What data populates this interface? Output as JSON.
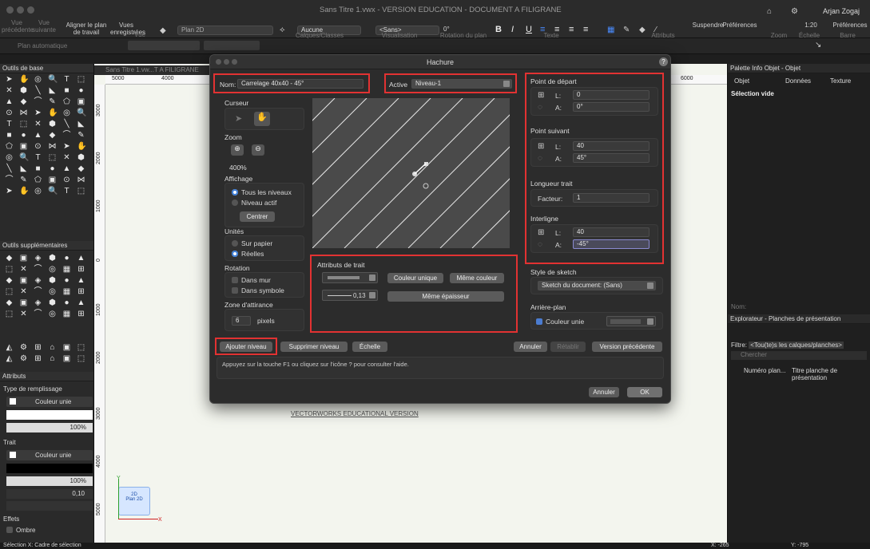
{
  "window": {
    "title": "Sans Titre 1.vwx - VERSION EDUCATION - DOCUMENT A FILIGRANE",
    "user": "Arjan Zogaj"
  },
  "toolbar": {
    "vue_precedente": "Vue précédente",
    "vue_suivante": "Vue suivante",
    "aligner": "Aligner le plan de travail",
    "vues_enregistrees": "Vues enregistrées",
    "vue_group": "Vue",
    "plan_2d": "Plan 2D",
    "calques_value": "Aucune",
    "calques_group": "Calques/Classes",
    "visu_group": "Visualisation",
    "sans_value": "<Sans>",
    "rotation_value": "0°",
    "rotation_group": "Rotation du plan",
    "texte_group": "Texte",
    "attributs_group": "Attributs",
    "suspendre": "Suspendre",
    "preferences": "Préférences",
    "zoom_group": "Zoom",
    "echelle_value": "1:20",
    "echelle_group": "Échelle",
    "preferences2": "Préférences",
    "barre": "Barre d'affichage",
    "plan_auto": "Plan automatique"
  },
  "left": {
    "outils_de_base": "Outils de base",
    "outils_supp": "Outils supplémentaires",
    "attributs": "Attributs",
    "type_remplissage": "Type de remplissage",
    "couleur_unie": "Couleur unie",
    "percent_a": "100%",
    "trait": "Trait",
    "couleur_unie2": "Couleur unie",
    "percent_b": "100%",
    "thickness": "0,10",
    "effets": "Effets",
    "ombre": "Ombre"
  },
  "drawing": {
    "tab_title": "Sans Titre 1.vw...T A FILIGRANE",
    "ruler_top": [
      "5000",
      "4000",
      "6000"
    ],
    "ruler_left": [
      "3000",
      "2000",
      "1000",
      "0",
      "1000",
      "2000",
      "3000",
      "4000",
      "5000"
    ],
    "watermark": "VECTORWORKS EDUCATIONAL VERSION",
    "view_badge_top": "2D",
    "view_badge_bottom": "Plan 2D",
    "axis_y": "Y",
    "axis_x": "X"
  },
  "statusbar": {
    "left": "Sélection  X: Cadre de sélection",
    "x": "X: -265",
    "y": "Y: -795"
  },
  "dialog": {
    "title": "Hachure",
    "help": "?",
    "nom_label": "Nom:",
    "nom_value": "Carrelage 40x40 - 45°",
    "active_label": "Active",
    "active_value": "Niveau-1",
    "curseur": "Curseur",
    "zoom": "Zoom",
    "zoom_value": "400%",
    "affichage": "Affichage",
    "tous_niveaux": "Tous les niveaux",
    "niveau_actif": "Niveau actif",
    "centrer": "Centrer",
    "unites": "Unités",
    "sur_papier": "Sur papier",
    "reelles": "Réelles",
    "rotation": "Rotation",
    "dans_mur": "Dans mur",
    "dans_symbole": "Dans symbole",
    "zone": "Zone d'attirance",
    "zone_value": "6",
    "zone_unit": "pixels",
    "attributs_trait": "Attributs de trait",
    "couleur_unique": "Couleur unique",
    "meme_couleur": "Même couleur",
    "epaisseur_value": "0,13",
    "meme_epaisseur": "Même épaisseur",
    "point_depart": "Point de départ",
    "pd_L": "0",
    "pd_A": "0°",
    "point_suivant": "Point suivant",
    "ps_L": "40",
    "ps_A": "45°",
    "longueur": "Longueur trait",
    "facteur_label": "Facteur:",
    "facteur_value": "1",
    "interligne": "Interligne",
    "il_L": "40",
    "il_A": "-45°",
    "L": "L:",
    "A": "A:",
    "style_sketch": "Style de sketch",
    "sketch_value": "Sketch du document: (Sans)",
    "arriere_plan": "Arrière-plan",
    "couleur_unie": "Couleur unie",
    "ajouter": "Ajouter niveau",
    "supprimer": "Supprimer niveau",
    "echelle": "Échelle",
    "annuler": "Annuler",
    "retablir": "Rétablir",
    "version_prec": "Version précédente",
    "help_text": "Appuyez sur la touche F1 ou cliquez sur l'icône ? pour consulter l'aide.",
    "annuler2": "Annuler",
    "ok": "OK"
  },
  "right": {
    "palette_info": "Palette Info Objet - Objet",
    "tab_objet": "Objet",
    "tab_donnees": "Données",
    "tab_texture": "Texture",
    "selection_vide": "Sélection vide",
    "nom_label": "Nom:",
    "explorateur": "Explorateur - Planches de présentation",
    "filtre_label": "Filtre:",
    "filtre_value": "<Tou(te)s les calques/planches>",
    "chercher": "Chercher",
    "col_numero": "Numéro plan...",
    "col_titre": "Titre planche de présentation"
  }
}
